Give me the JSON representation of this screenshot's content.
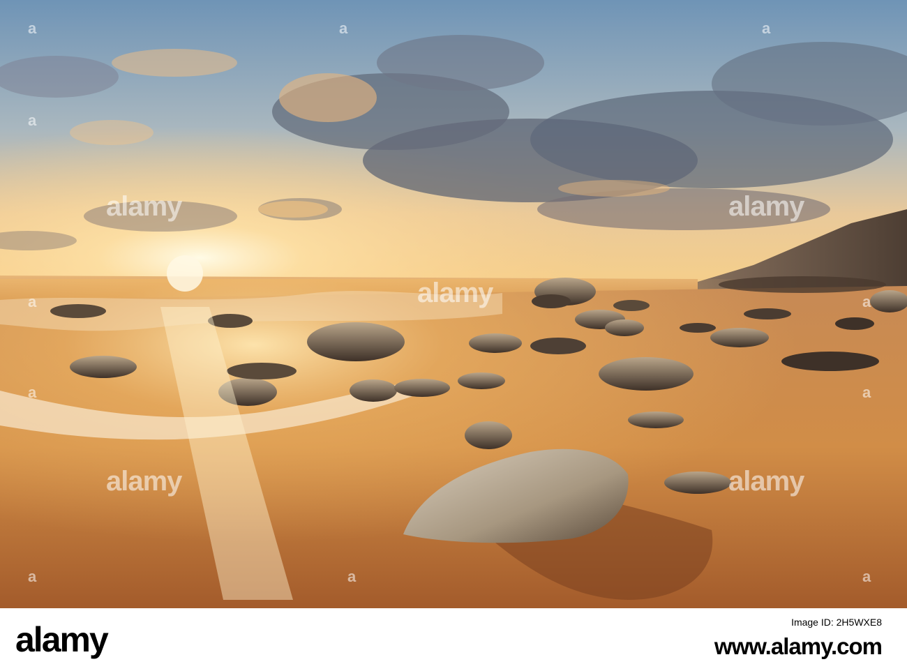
{
  "image": {
    "scene": "",
    "colors": {
      "sky_top": "#6f94b6",
      "sky_mid": "#c9c4b4",
      "sky_horizon": "#f6cf8a",
      "sun": "#fff6d8",
      "sea": "#d59a55",
      "sand_light": "#e4a65a",
      "sand_dark": "#9c5a2e",
      "rock": "#5a4a3a",
      "cloud_dark": "#5e6574",
      "cloud_lit": "#f2b877"
    }
  },
  "watermark": {
    "text": "alamy",
    "tick": "a"
  },
  "footer": {
    "logo": "alamy",
    "image_id": "Image ID: 2H5WXE8",
    "url": "www.alamy.com"
  }
}
